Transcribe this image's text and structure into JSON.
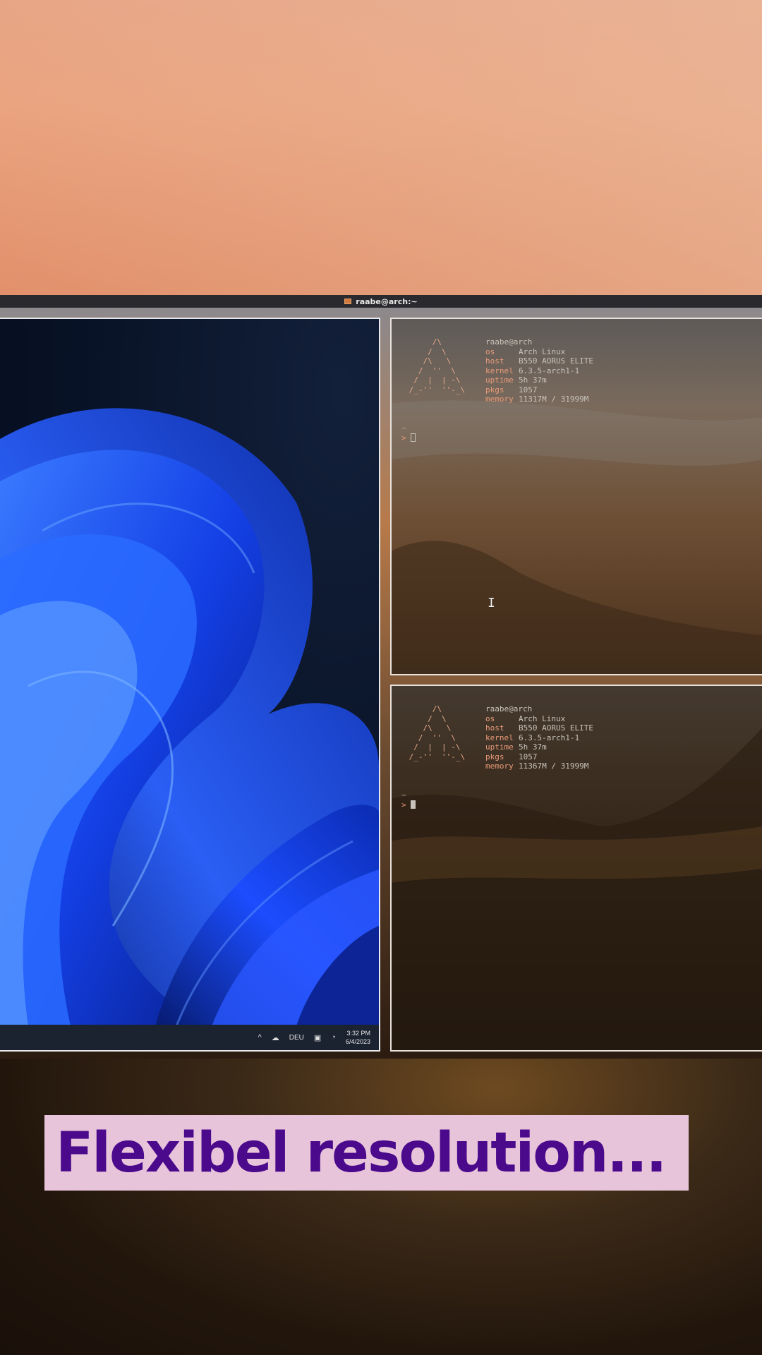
{
  "topbar": {
    "title": "raabe@arch:~",
    "icon": "terminal-window-icon"
  },
  "vm": {
    "taskbar": {
      "tray_chevron": "^",
      "cloud_icon": "cloud-icon",
      "language": "DEU",
      "notes_icon": "notes-icon",
      "network_icon": "network-sound-icon",
      "time": "3:32 PM",
      "date": "6/4/2023"
    }
  },
  "terminals": [
    {
      "title": "raabe@arch",
      "rows": [
        {
          "key": "os",
          "value": "Arch Linux"
        },
        {
          "key": "host",
          "value": "B550 AORUS ELITE"
        },
        {
          "key": "kernel",
          "value": "6.3.5-arch1-1"
        },
        {
          "key": "uptime",
          "value": "5h 37m"
        },
        {
          "key": "pkgs",
          "value": "1057"
        },
        {
          "key": "memory",
          "value": "11317M / 31999M"
        }
      ],
      "tilde": "~",
      "prompt": ">"
    },
    {
      "title": "raabe@arch",
      "rows": [
        {
          "key": "os",
          "value": "Arch Linux"
        },
        {
          "key": "host",
          "value": "B550 AORUS ELITE"
        },
        {
          "key": "kernel",
          "value": "6.3.5-arch1-1"
        },
        {
          "key": "uptime",
          "value": "5h 37m"
        },
        {
          "key": "pkgs",
          "value": "1057"
        },
        {
          "key": "memory",
          "value": "11367M / 31999M"
        }
      ],
      "tilde": "~",
      "prompt": ">"
    }
  ],
  "caption": {
    "text": "Flexibel resolution..."
  },
  "colors": {
    "accent_terminal": "#e89a78",
    "caption_bg": "#e8c4da",
    "caption_text": "#4b0a8c"
  }
}
